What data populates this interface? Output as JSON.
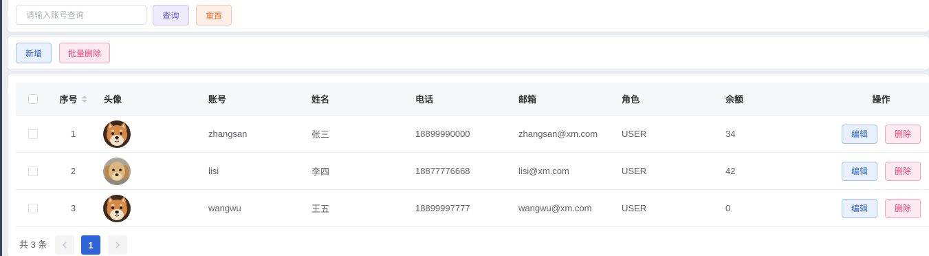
{
  "colors": {
    "primary": "#2f63d8",
    "danger": "#e8467a",
    "purple": "#6b5bd6",
    "warning": "#f2773a",
    "sidebar": "#3a4456"
  },
  "search": {
    "placeholder": "请输入账号查询",
    "value": "",
    "query_label": "查询",
    "reset_label": "重置"
  },
  "toolbar": {
    "add_label": "新增",
    "batch_delete_label": "批量删除"
  },
  "table": {
    "headers": {
      "index": "序号",
      "avatar": "头像",
      "username": "账号",
      "name": "姓名",
      "phone": "电话",
      "email": "邮箱",
      "role": "角色",
      "balance": "余额",
      "actions": "操作"
    },
    "select_all": false,
    "sort_icon": "sort-caret-icon",
    "rows": [
      {
        "selected": false,
        "index": "1",
        "avatar_icon": "shiba-dog-avatar",
        "username": "zhangsan",
        "name": "张三",
        "phone": "18899990000",
        "email": "zhangsan@xm.com",
        "role": "USER",
        "balance": "34",
        "edit_label": "编辑",
        "delete_label": "删除"
      },
      {
        "selected": false,
        "index": "2",
        "avatar_icon": "puppy-dog-avatar",
        "username": "lisi",
        "name": "李四",
        "phone": "18877776668",
        "email": "lisi@xm.com",
        "role": "USER",
        "balance": "42",
        "edit_label": "编辑",
        "delete_label": "删除"
      },
      {
        "selected": false,
        "index": "3",
        "avatar_icon": "shiba-dog-avatar",
        "username": "wangwu",
        "name": "王五",
        "phone": "18899997777",
        "email": "wangwu@xm.com",
        "role": "USER",
        "balance": "0",
        "edit_label": "编辑",
        "delete_label": "删除"
      }
    ]
  },
  "pagination": {
    "total_text": "共 3 条",
    "current_page": "1",
    "prev_icon": "chevron-left-icon",
    "next_icon": "chevron-right-icon"
  }
}
